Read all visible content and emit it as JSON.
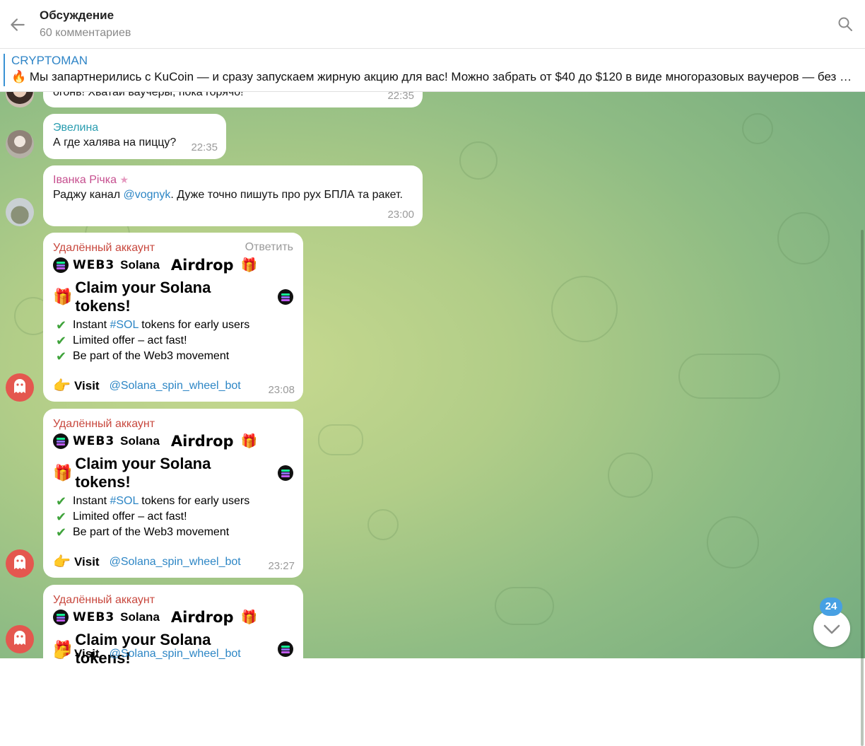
{
  "header": {
    "title": "Обсуждение",
    "subtitle": "60 комментариев"
  },
  "pinned": {
    "name": "CRYPTOMAN",
    "text": "🔥 Мы запартнерились с KuCoin — и сразу запускаем жирную акцию для вас!  Можно забрать от $40 до $120 в виде многоразовых ваучеров — без ог..."
  },
  "messages": [
    {
      "text": "огонь! Хватай ваучеры, пока горячо!",
      "time": "22:35"
    },
    {
      "sender": "Эвелина",
      "sender_color": "#2a9db0",
      "text": "А где халява на пиццу?",
      "time": "22:35"
    },
    {
      "sender": "Іванка Річка",
      "sender_color": "#c64f8f",
      "star": "★",
      "text_before": "Раджу канал ",
      "mention": "@vognyk",
      "text_after": ". Дуже точно пишуть про рух БПЛА та ракет.",
      "time": "23:00"
    }
  ],
  "promo": {
    "sender": "Удалённый аккаунт",
    "sender_color": "#c8483e",
    "reply_label": "Ответить",
    "web3": "WEB3",
    "solana": "Solana",
    "airdrop": "Airdrop",
    "gift_icon": "🎁",
    "claim": "Claim your Solana tokens!",
    "check_icon": "✔",
    "check1_before": "Instant ",
    "check1_tag": "#SOL",
    "check1_after": " tokens for early users",
    "check2": "Limited offer – act fast!",
    "check3": "Be part of the Web3 movement",
    "hand_icon": "👉",
    "visit": "Visit",
    "bot": "@Solana_spin_wheel_bot",
    "times": [
      "23:08",
      "23:27"
    ]
  },
  "scroll_badge": "24",
  "colors": {
    "accent": "#2f85c7",
    "deleted_avatar": "#e4574f"
  }
}
